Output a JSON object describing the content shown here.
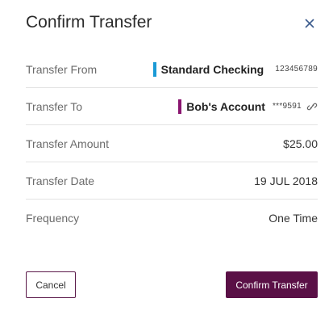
{
  "dialog": {
    "title": "Confirm Transfer",
    "close_icon": "close-icon"
  },
  "rows": [
    {
      "label": "Transfer From",
      "account_name": "Standard Checking",
      "account_number": "123456789",
      "accent_color": "#1a9ad6"
    },
    {
      "label": "Transfer To",
      "account_name": "Bob's Account",
      "account_number": "***9591",
      "accent_color": "#8a1670",
      "icon": "link-icon"
    },
    {
      "label": "Transfer Amount",
      "value": "$25.00"
    },
    {
      "label": "Transfer Date",
      "value": "19 JUL 2018"
    },
    {
      "label": "Frequency",
      "value": "One Time"
    }
  ],
  "buttons": {
    "cancel_label": "Cancel",
    "confirm_label": "Confirm Transfer"
  },
  "colors": {
    "primary": "#5a1046",
    "close_icon": "#3a5a8c"
  }
}
